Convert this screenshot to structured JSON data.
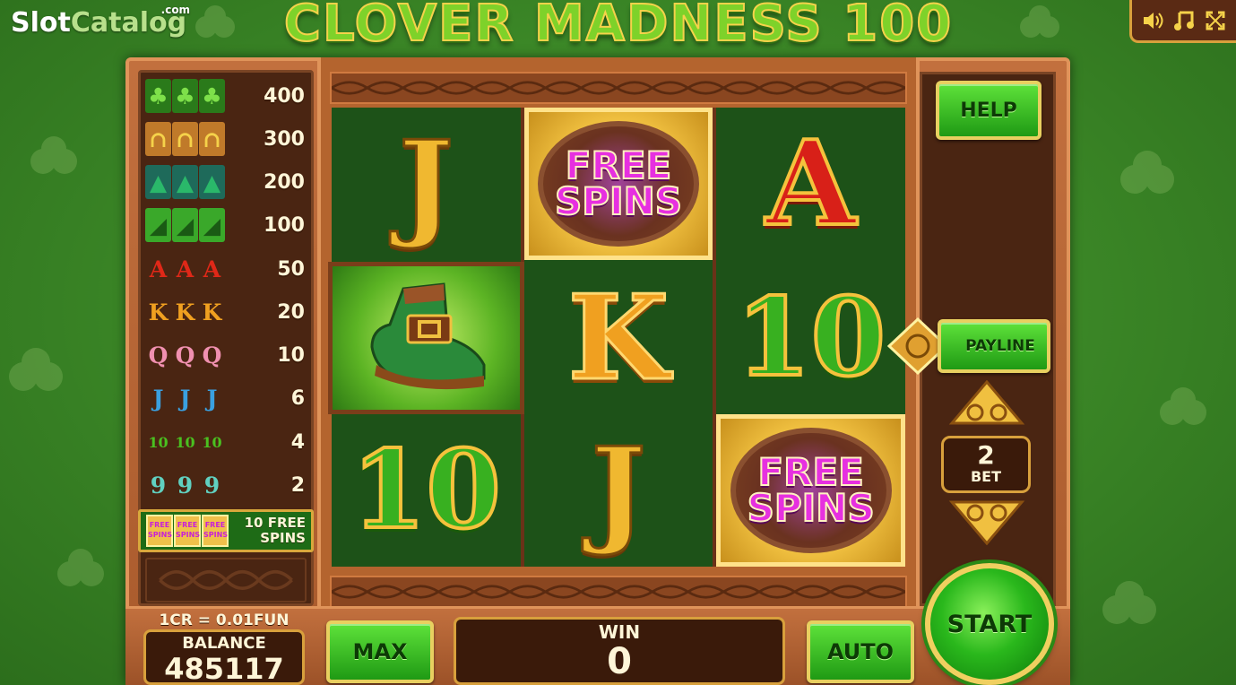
{
  "watermark": {
    "brand_slot": "Slot",
    "brand_catalog": "Catalog",
    "brand_com": ".com"
  },
  "game": {
    "title": "CLOVER MADNESS 100"
  },
  "audio": {
    "icons": [
      "speaker-icon",
      "music-note-icon",
      "fullscreen-icon"
    ]
  },
  "paytable": {
    "rows": [
      {
        "symbol": "clover",
        "value": "400"
      },
      {
        "symbol": "horseshoe",
        "value": "300"
      },
      {
        "symbol": "leprechaun-hat",
        "value": "200"
      },
      {
        "symbol": "boot",
        "value": "100"
      },
      {
        "symbol": "A",
        "value": "50"
      },
      {
        "symbol": "K",
        "value": "20"
      },
      {
        "symbol": "Q",
        "value": "10"
      },
      {
        "symbol": "J",
        "value": "6"
      },
      {
        "symbol": "10",
        "value": "4"
      },
      {
        "symbol": "9",
        "value": "2"
      }
    ],
    "free_spins": {
      "label_line1": "10 FREE",
      "label_line2": "SPINS",
      "mini_text": "FREE SPINS"
    }
  },
  "reels": {
    "symbols": [
      [
        "J",
        "boot",
        "10"
      ],
      [
        "FREE SPINS",
        "K",
        "J"
      ],
      [
        "A",
        "10",
        "FREE SPINS"
      ]
    ],
    "free_spins_line1": "FREE",
    "free_spins_line2": "SPINS"
  },
  "controls": {
    "help": "HELP",
    "payline": "PAYLINE",
    "bet_value": "2",
    "bet_label": "BET",
    "rate": "1CR = 0.01FUN",
    "balance_label": "BALANCE",
    "balance_value": "485117",
    "max": "MAX",
    "win_label": "WIN",
    "win_value": "0",
    "auto": "AUTO",
    "start": "START"
  },
  "colors": {
    "felt_green": "#3d8a28",
    "wood": "#b4642e",
    "button_green": "#2ab81c",
    "gold": "#d8a03c"
  }
}
